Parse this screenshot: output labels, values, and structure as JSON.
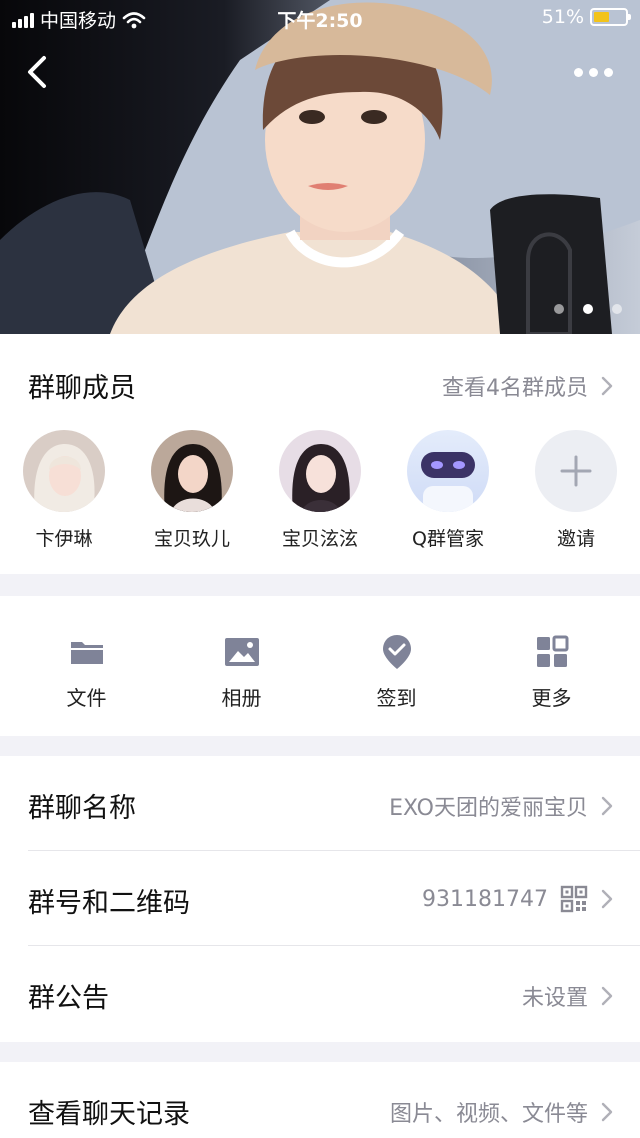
{
  "status_bar": {
    "carrier": "中国移动",
    "time": "下午2:50",
    "battery": "51%",
    "battery_level": 0.51
  },
  "banner": {
    "page_count": 3,
    "active_page": 2
  },
  "members_section": {
    "title": "群聊成员",
    "view_all": "查看4名群成员",
    "members": [
      {
        "name": "卞伊琳"
      },
      {
        "name": "宝贝玖儿"
      },
      {
        "name": "宝贝泫泫"
      },
      {
        "name": "Q群管家"
      }
    ],
    "invite_label": "邀请"
  },
  "tools": [
    {
      "label": "文件",
      "icon": "folder-icon"
    },
    {
      "label": "相册",
      "icon": "album-icon"
    },
    {
      "label": "签到",
      "icon": "checkin-icon"
    },
    {
      "label": "更多",
      "icon": "grid-icon"
    }
  ],
  "info": {
    "group_name_label": "群聊名称",
    "group_name_value": "EXO天团的爱丽宝贝",
    "group_number_label": "群号和二维码",
    "group_number_value": "931181747",
    "announcement_label": "群公告",
    "announcement_value": "未设置"
  },
  "records": {
    "label": "查看聊天记录",
    "value": "图片、视频、文件等"
  },
  "colors": {
    "icon_gray": "#7f8398",
    "accent_purple": "#6b5cff"
  }
}
